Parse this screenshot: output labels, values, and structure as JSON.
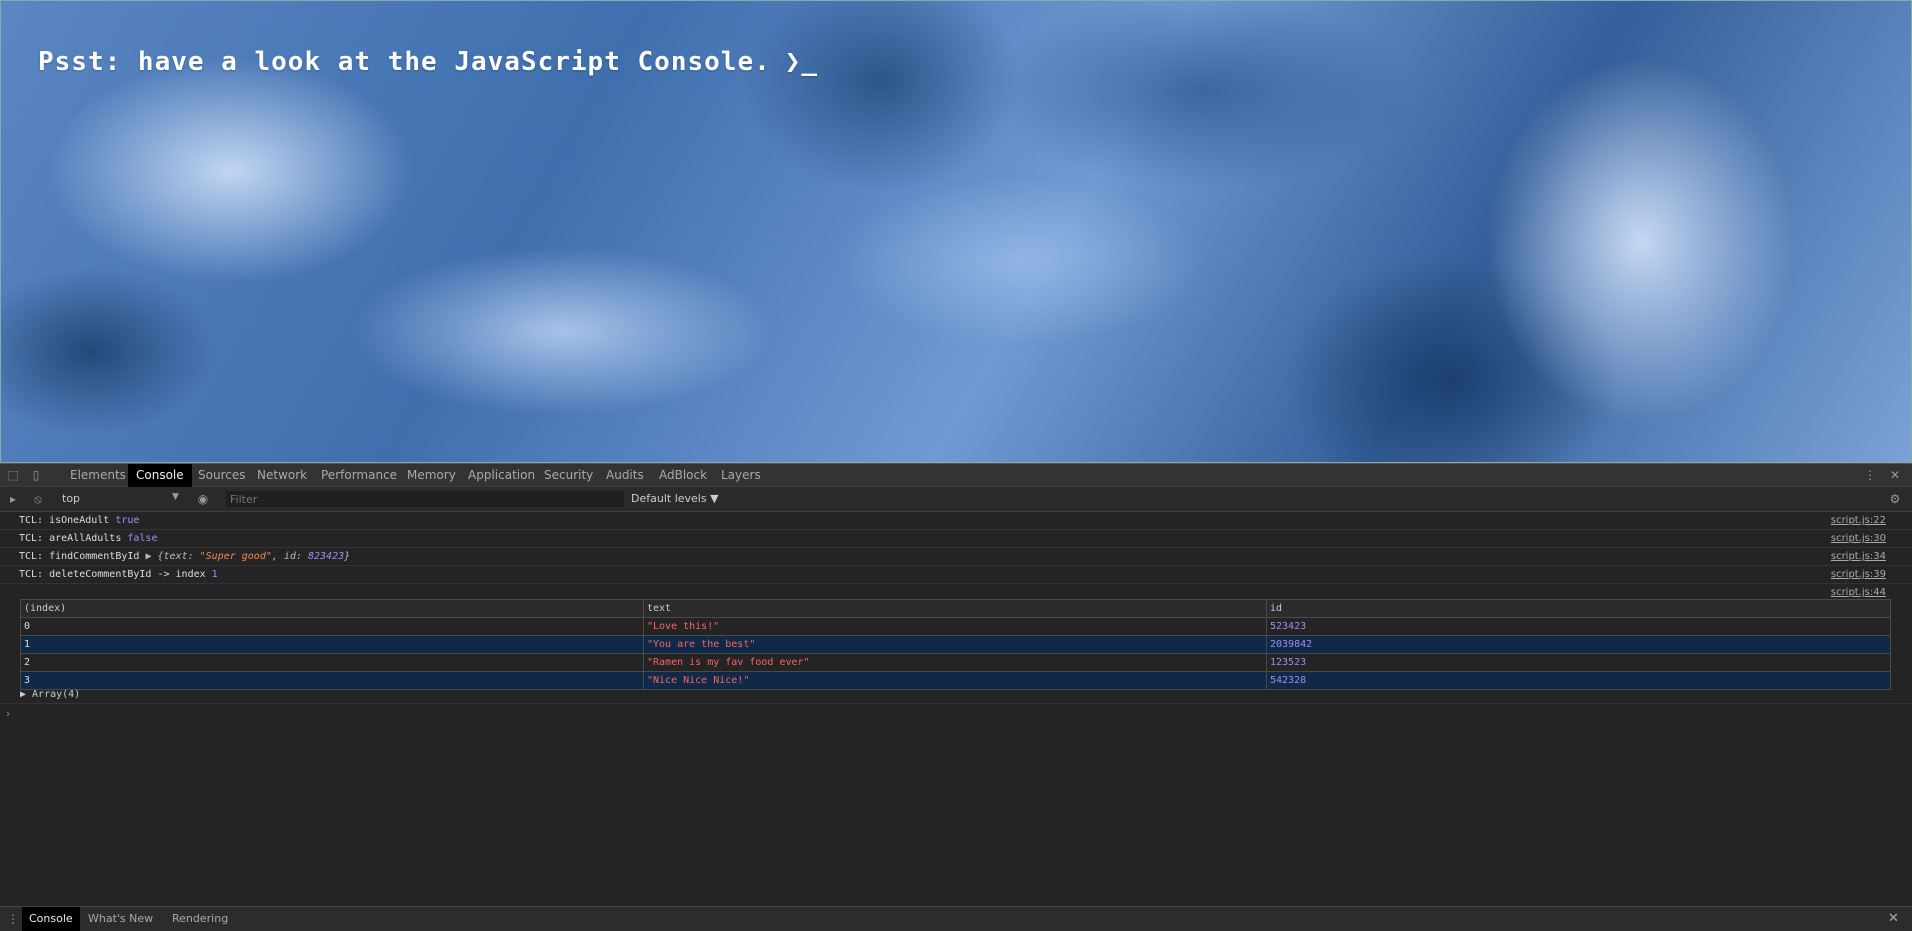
{
  "hero": {
    "message": "Psst: have a look at the JavaScript Console.",
    "prompt_glyph": "❯_"
  },
  "devtools": {
    "tabs": [
      "Elements",
      "Console",
      "Sources",
      "Network",
      "Performance",
      "Memory",
      "Application",
      "Security",
      "Audits",
      "AdBlock",
      "Layers"
    ],
    "active_tab": "Console",
    "toolbar": {
      "context": "top",
      "filter_placeholder": "Filter",
      "levels": "Default levels ▼"
    },
    "logs": [
      {
        "prefix": "TCL: isOneAdult ",
        "value": "true",
        "source": "script.js:22"
      },
      {
        "prefix": "TCL: areAllAdults ",
        "value": "false",
        "source": "script.js:30"
      },
      {
        "prefix": "TCL: findCommentById ",
        "obj_open": "▶ {text: ",
        "obj_text": "\"Super good\"",
        "obj_mid": ", id: ",
        "obj_id": "823423",
        "obj_close": "}",
        "source": "script.js:34"
      },
      {
        "prefix": "TCL: deleteCommentById -> index ",
        "value": "1",
        "source": "script.js:39"
      },
      {
        "prefix": "",
        "value": "",
        "source": "script.js:44"
      }
    ],
    "table": {
      "headers": [
        "(index)",
        "text",
        "id"
      ],
      "rows": [
        {
          "index": "0",
          "text": "\"Love this!\"",
          "id": "523423"
        },
        {
          "index": "1",
          "text": "\"You are the best\"",
          "id": "2039842"
        },
        {
          "index": "2",
          "text": "\"Ramen is my fav food ever\"",
          "id": "123523"
        },
        {
          "index": "3",
          "text": "\"Nice Nice Nice!\"",
          "id": "542328"
        }
      ]
    },
    "array_summary": "▶ Array(4)",
    "prompt_caret": "›",
    "drawer_tabs": [
      "Console",
      "What's New",
      "Rendering"
    ],
    "drawer_active": "Console"
  }
}
